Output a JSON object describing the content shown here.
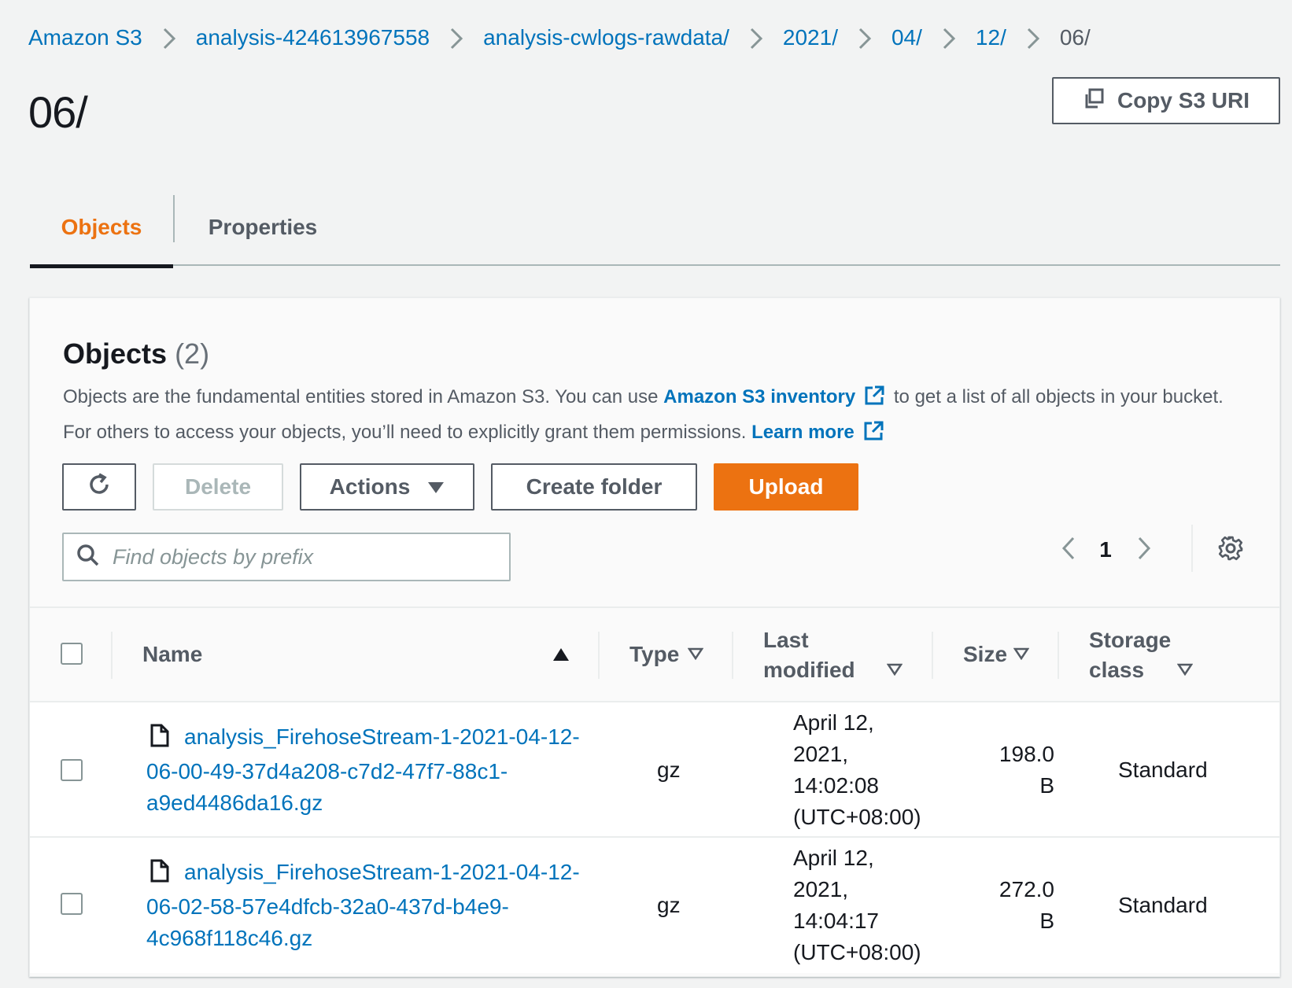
{
  "breadcrumb": [
    {
      "label": "Amazon S3"
    },
    {
      "label": "analysis-424613967558"
    },
    {
      "label": "analysis-cwlogs-rawdata/"
    },
    {
      "label": "2021/"
    },
    {
      "label": "04/"
    },
    {
      "label": "12/"
    },
    {
      "label": "06/"
    }
  ],
  "page_title": "06/",
  "copy_uri_label": "Copy S3 URI",
  "tabs": [
    {
      "label": "Objects",
      "active": true
    },
    {
      "label": "Properties",
      "active": false
    }
  ],
  "objects_panel": {
    "title": "Objects",
    "count": "(2)",
    "desc_part1": "Objects are the fundamental entities stored in Amazon S3. You can use ",
    "inventory_link": "Amazon S3 inventory",
    "desc_part2": " to get a list of all objects in your bucket. For others to access your objects, you’ll need to explicitly grant them permissions. ",
    "learn_more": "Learn more"
  },
  "toolbar": {
    "delete_label": "Delete",
    "actions_label": "Actions",
    "create_folder_label": "Create folder",
    "upload_label": "Upload"
  },
  "search": {
    "placeholder": "Find objects by prefix",
    "value": ""
  },
  "pagination": {
    "current_page": "1"
  },
  "table": {
    "columns": {
      "name": "Name",
      "type": "Type",
      "last_modified_line1": "Last",
      "last_modified_line2": "modified",
      "size": "Size",
      "storage_class_line1": "Storage",
      "storage_class_line2": "class"
    },
    "sort": {
      "column": "Name",
      "direction": "ascending"
    },
    "rows": [
      {
        "name_line1": "analysis_FirehoseStream-1-2021-04-12-",
        "name_line2": "06-00-49-37d4a208-c7d2-47f7-88c1-",
        "name_line3": "a9ed4486da16.gz",
        "type": "gz",
        "modified_line1": "April 12,",
        "modified_line2": "2021,",
        "modified_line3": "14:02:08",
        "modified_line4": "(UTC+08:00)",
        "size_line1": "198.0",
        "size_line2": "B",
        "storage_class": "Standard"
      },
      {
        "name_line1": "analysis_FirehoseStream-1-2021-04-12-",
        "name_line2": "06-02-58-57e4dfcb-32a0-437d-b4e9-",
        "name_line3": "4c968f118c46.gz",
        "type": "gz",
        "modified_line1": "April 12,",
        "modified_line2": "2021,",
        "modified_line3": "14:04:17",
        "modified_line4": "(UTC+08:00)",
        "size_line1": "272.0",
        "size_line2": "B",
        "storage_class": "Standard"
      }
    ]
  },
  "colors": {
    "link": "#0073bb",
    "accent_orange": "#ec7211",
    "text_dark": "#16191f",
    "text_secondary": "#545b64",
    "background": "#f2f3f3"
  },
  "icons": {
    "separator": "chevron-right-icon",
    "copy": "copy-icon",
    "external_link": "external-link-icon",
    "refresh": "refresh-icon",
    "dropdown": "caret-down-icon",
    "search": "search-icon",
    "prev_page": "chevron-left-icon",
    "next_page": "chevron-right-icon",
    "settings": "gear-icon",
    "file": "file-icon",
    "sort_asc": "sort-ascending-icon",
    "sort_none": "sort-caret-icon"
  }
}
